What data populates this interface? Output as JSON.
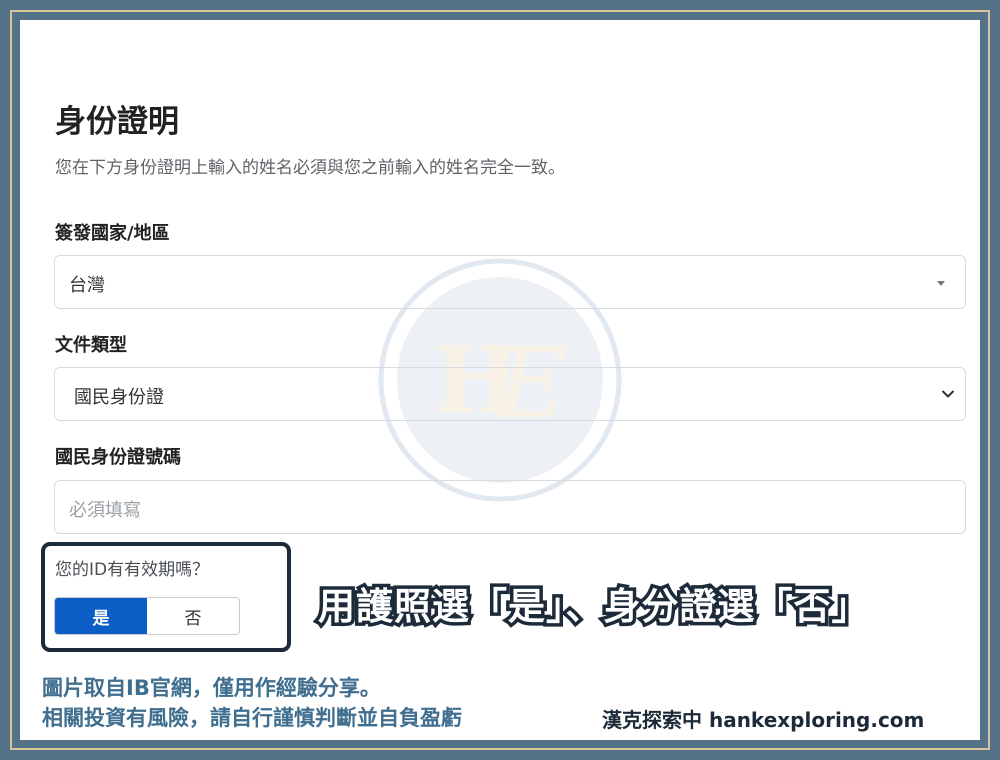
{
  "colors": {
    "frame": "#537288",
    "gold_border": "#d8c39a",
    "primary": "#0b5ec5",
    "dark": "#1d2a3a",
    "credit": "#3f6e8f"
  },
  "watermark": {
    "letters": "HE"
  },
  "page": {
    "title": "身份證明",
    "subtitle": "您在下方身份證明上輸入的姓名必須與您之前輸入的姓名完全一致。"
  },
  "form": {
    "country": {
      "label": "簽發國家/地區",
      "value": "台灣"
    },
    "doc_type": {
      "label": "文件類型",
      "value": "國民身份證"
    },
    "id_number": {
      "label": "國民身份證號碼",
      "placeholder": "必須填寫"
    },
    "expiry": {
      "question": "您的ID有有效期嗎？",
      "yes_label": "是",
      "no_label": "否",
      "selected": "是"
    }
  },
  "annotation": {
    "callout": "用護照選「是」、身分證選「否」",
    "credit_line1": "圖片取自IB官網，僅用作經驗分享。",
    "credit_line2": "相關投資有風險，請自行謹慎判斷並自負盈虧",
    "brand": "漢克探索中 hankexploring.com"
  }
}
